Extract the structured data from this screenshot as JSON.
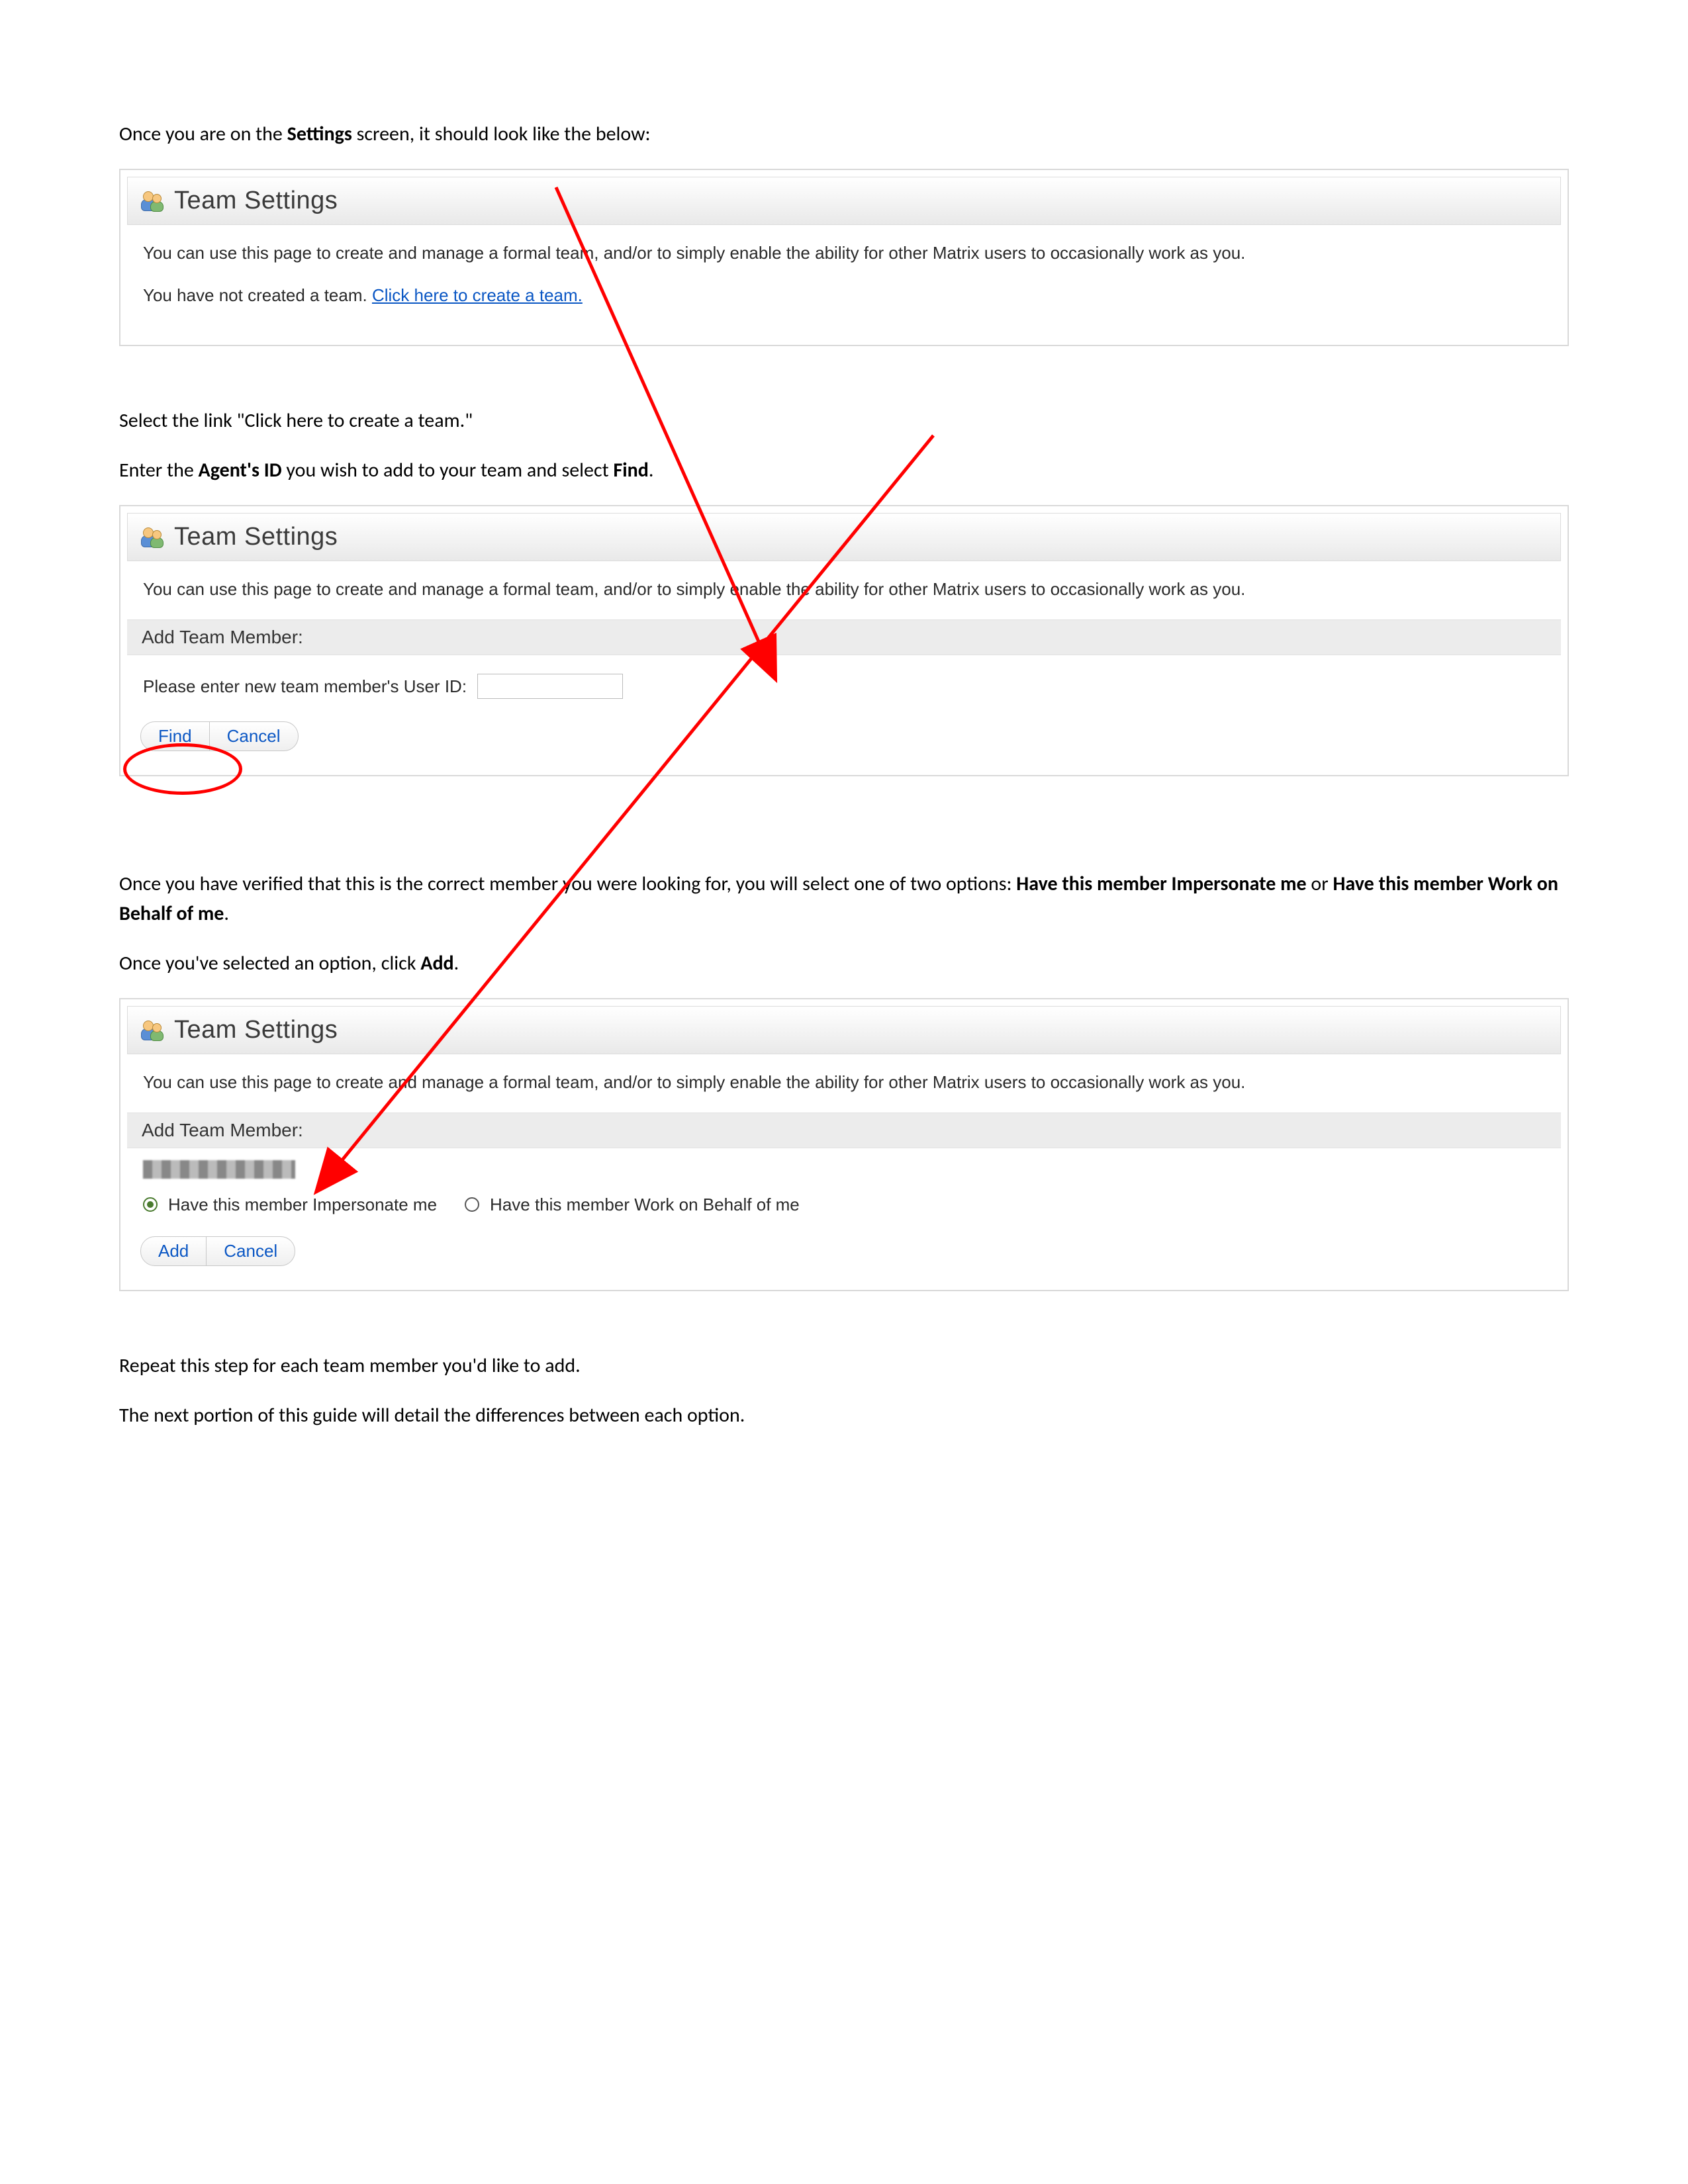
{
  "intro": {
    "p1_prefix": "Once you are on the ",
    "p1_bold": "Settings",
    "p1_suffix": " screen, it should look like the below:"
  },
  "panel1": {
    "title": "Team Settings",
    "desc": "You can use this page to create and manage a formal team, and/or to simply enable the ability for other Matrix users to occasionally work as you.",
    "no_team_prefix": "You have not created a team. ",
    "create_link": "Click here to create a team."
  },
  "step2": {
    "p1": "Select the link \"Click here to create a team.\"",
    "p2_a": "Enter the ",
    "p2_bold": "Agent's ID",
    "p2_b": " you wish to add to your team and select ",
    "p2_bold2": "Find",
    "p2_c": "."
  },
  "panel2": {
    "title": "Team Settings",
    "desc": "You can use this page to create and manage a formal team, and/or to simply enable the ability for other Matrix users to occasionally work as you.",
    "subheader": "Add Team Member:",
    "field_label": "Please enter new team member's User ID:",
    "input_value": "",
    "find_label": "Find",
    "cancel_label": "Cancel"
  },
  "step3": {
    "p1_a": "Once you have verified that this is the correct member you were looking for, you will select one of two options: ",
    "p1_b1": "Have this member Impersonate me",
    "p1_mid": " or ",
    "p1_b2": "Have this member Work on Behalf of me",
    "p1_end": ".",
    "p2_a": "Once you've selected an option, click ",
    "p2_bold": "Add",
    "p2_b": "."
  },
  "panel3": {
    "title": "Team Settings",
    "desc": "You can use this page to create and manage a formal team, and/or to simply enable the ability for other Matrix users to occasionally work as you.",
    "subheader": "Add Team Member:",
    "radio1": "Have this member Impersonate me",
    "radio2": "Have this member Work on Behalf of me",
    "add_label": "Add",
    "cancel_label": "Cancel"
  },
  "closing": {
    "p1": "Repeat this step for each team member you'd like to add.",
    "p2": "The next portion of this guide will detail the differences between each option."
  }
}
